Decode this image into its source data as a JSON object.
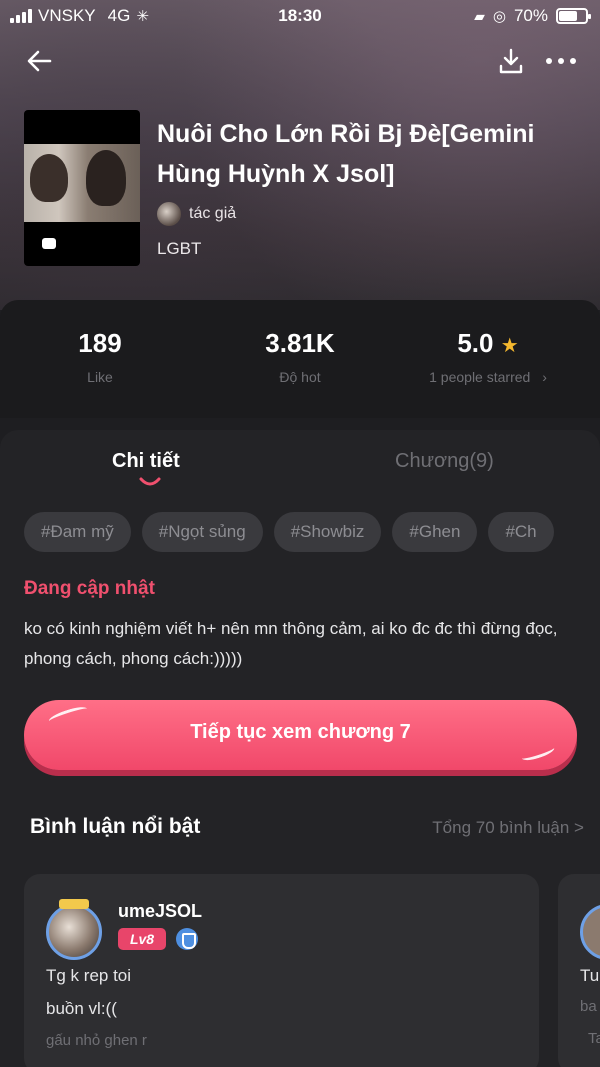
{
  "status_bar": {
    "carrier": "VNSKY",
    "network": "4G",
    "time": "18:30",
    "battery": "70%",
    "battery_level": 0.7
  },
  "book": {
    "title": "Nuôi Cho Lớn Rồi Bj Đè[Gemini Hùng Huỳnh X Jsol]",
    "author_label": "tác giả",
    "genre": "LGBT"
  },
  "stats": {
    "likes": {
      "value": "189",
      "label": "Like"
    },
    "hot": {
      "value": "3.81K",
      "label": "Độ hot"
    },
    "rating": {
      "value": "5.0",
      "label": "1 people starred",
      "chevron": "›"
    }
  },
  "tabs": {
    "detail": "Chi tiết",
    "chapters": "Chương(9)"
  },
  "tags": [
    "#Đam mỹ",
    "#Ngọt sủng",
    "#Showbiz",
    "#Ghen",
    "#Ch"
  ],
  "status_text": "Đang cập nhật",
  "description": "ko có kinh nghiệm viết h+ nên mn thông cảm, ai ko đc đc thì đừng đọc, phong cách, phong cách:)))))",
  "cta": {
    "label": "Tiếp tục xem chương 7"
  },
  "comments": {
    "title": "Bình luận nổi bật",
    "total": "Tổng 70 bình luận >",
    "items": [
      {
        "user": "umeJSOL",
        "level": "Lv8",
        "line1": "Tg k rep toi",
        "line2": "buồn vl:((",
        "line3": "gấu nhỏ ghen r"
      },
      {
        "line1": "Tu",
        "line2": "ba",
        "line3": "Ta"
      }
    ]
  },
  "colors": {
    "accent": "#f0506e",
    "background": "#232326",
    "star": "#f5b82e"
  },
  "icons": [
    "back-arrow-icon",
    "download-icon",
    "more-icon",
    "star-icon",
    "chat-icon",
    "shield-icon"
  ]
}
